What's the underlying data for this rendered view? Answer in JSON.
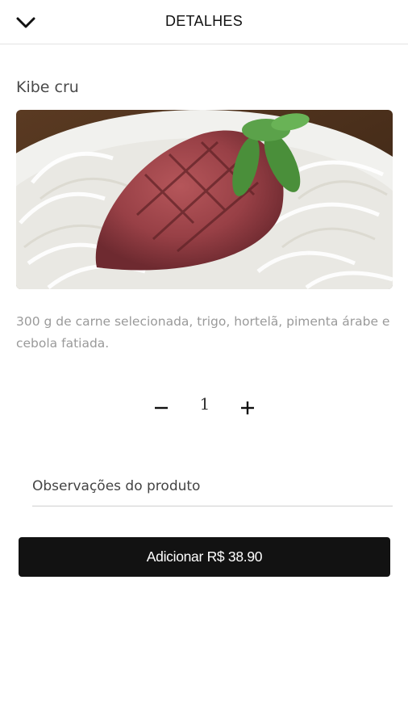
{
  "header": {
    "title": "DETALHES",
    "back_icon": "chevron-down-icon"
  },
  "product": {
    "name": "Kibe cru",
    "image_description": "Kibe cru servido sobre cebola fatiada com folhas de hortelã",
    "description": "300 g de carne selecionada, trigo, hortelã, pimenta árabe e cebola fatiada."
  },
  "quantity": {
    "value": "1",
    "minus_icon": "minus-icon",
    "plus_icon": "plus-icon"
  },
  "notes": {
    "placeholder": "Observações do produto",
    "value": ""
  },
  "add_button": {
    "label": "Adicionar R$ 38.90"
  },
  "colors": {
    "button_bg": "#121212",
    "description_text": "#9a9a9a",
    "divider": "#e3e3e3"
  }
}
